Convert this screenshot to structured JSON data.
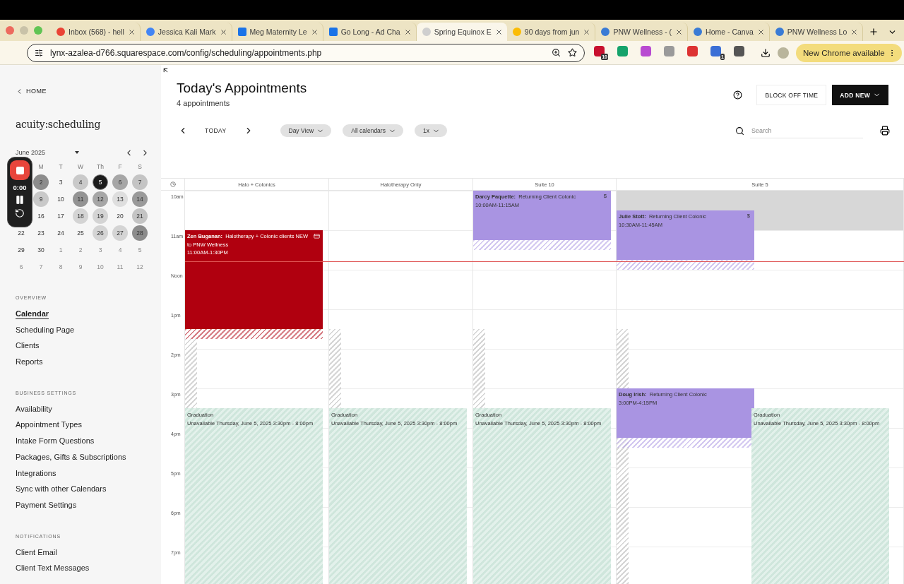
{
  "browser": {
    "tabs": [
      {
        "kind": "gmail",
        "title": "Inbox (568) - hell",
        "selected": false
      },
      {
        "kind": "calendar",
        "title": "Jessica Kali Mark",
        "selected": false
      },
      {
        "kind": "docs",
        "title": "Meg Maternity Le",
        "selected": false
      },
      {
        "kind": "docs",
        "title": "Go Long - Ad Cha",
        "selected": false
      },
      {
        "kind": "site",
        "title": "Spring Equinox E",
        "selected": true
      },
      {
        "kind": "google",
        "title": "90 days from jun",
        "selected": false
      },
      {
        "kind": "canva",
        "title": "PNW Wellness - (",
        "selected": false
      },
      {
        "kind": "canva",
        "title": "Home - Canva",
        "selected": false
      },
      {
        "kind": "canva",
        "title": "PNW Wellness Lo",
        "selected": false
      }
    ],
    "url": "lynx-azalea-d766.squarespace.com/config/scheduling/appointments.php",
    "extensions": [
      {
        "kind": "calendar",
        "badge": "10"
      },
      {
        "kind": "grammar"
      },
      {
        "kind": "orb"
      },
      {
        "kind": "camera"
      },
      {
        "kind": "chart"
      },
      {
        "kind": "tag",
        "badge": "1"
      },
      {
        "kind": "puzzle"
      }
    ],
    "update_button": "New Chrome available"
  },
  "sidebar": {
    "home": "HOME",
    "logo": "acuity:scheduling",
    "mini_calendar": {
      "month": "June 2025",
      "weekdays": [
        "M",
        "T",
        "W",
        "Th",
        "F",
        "S"
      ],
      "weeks": [
        [
          {
            "d": "2",
            "outside": false,
            "selected": false,
            "color": "#8c8c8c"
          },
          {
            "d": "3",
            "outside": false,
            "selected": false
          },
          {
            "d": "4",
            "outside": false,
            "selected": false,
            "color": "#c9c9c9"
          },
          {
            "d": "5",
            "outside": false,
            "selected": true
          },
          {
            "d": "6",
            "outside": false,
            "selected": false,
            "color": "#a6a6a6"
          },
          {
            "d": "7",
            "outside": false,
            "selected": false,
            "color": "#c4c4c4"
          }
        ],
        [
          {
            "d": "9",
            "outside": false,
            "selected": false,
            "color": "#c9c9c9"
          },
          {
            "d": "10",
            "outside": false,
            "selected": false
          },
          {
            "d": "11",
            "outside": false,
            "selected": false,
            "color": "#939393"
          },
          {
            "d": "12",
            "outside": false,
            "selected": false,
            "color": "#a6a6a6"
          },
          {
            "d": "13",
            "outside": false,
            "selected": false,
            "color": "#dedede"
          },
          {
            "d": "14",
            "outside": false,
            "selected": false,
            "color": "#9a9a9a"
          }
        ],
        [
          {
            "d": "16",
            "outside": false,
            "selected": false
          },
          {
            "d": "17",
            "outside": false,
            "selected": false
          },
          {
            "d": "18",
            "outside": false,
            "selected": false,
            "color": "#d4d4d4"
          },
          {
            "d": "19",
            "outside": false,
            "selected": false,
            "color": "#d4d4d4"
          },
          {
            "d": "20",
            "outside": false,
            "selected": false
          },
          {
            "d": "21",
            "outside": false,
            "selected": false,
            "color": "#c4c4c4"
          }
        ],
        [
          {
            "d": "22",
            "outside": false,
            "selected": false
          },
          {
            "d": "23",
            "outside": false,
            "selected": false
          },
          {
            "d": "24",
            "outside": false,
            "selected": false
          },
          {
            "d": "25",
            "outside": false,
            "selected": false
          },
          {
            "d": "26",
            "outside": false,
            "selected": false,
            "color": "#d4d4d4"
          },
          {
            "d": "27",
            "outside": false,
            "selected": false,
            "color": "#d4d4d4"
          },
          {
            "d": "28",
            "outside": false,
            "selected": false,
            "color": "#8c8c8c"
          }
        ],
        [
          {
            "d": "29",
            "outside": false,
            "selected": false
          },
          {
            "d": "30",
            "outside": false,
            "selected": false
          },
          {
            "d": "1",
            "outside": true,
            "selected": false
          },
          {
            "d": "2",
            "outside": true,
            "selected": false
          },
          {
            "d": "3",
            "outside": true,
            "selected": false
          },
          {
            "d": "4",
            "outside": true,
            "selected": false
          },
          {
            "d": "5",
            "outside": true,
            "selected": false
          }
        ],
        [
          {
            "d": "6",
            "outside": true,
            "selected": false
          },
          {
            "d": "7",
            "outside": true,
            "selected": false
          },
          {
            "d": "8",
            "outside": true,
            "selected": false
          },
          {
            "d": "9",
            "outside": true,
            "selected": false
          },
          {
            "d": "10",
            "outside": true,
            "selected": false
          },
          {
            "d": "11",
            "outside": true,
            "selected": false
          },
          {
            "d": "12",
            "outside": true,
            "selected": false
          }
        ]
      ]
    },
    "sections": [
      {
        "title": "OVERVIEW",
        "items": [
          {
            "label": "Calendar",
            "selected": true
          },
          {
            "label": "Scheduling Page",
            "selected": false
          },
          {
            "label": "Clients",
            "selected": false
          },
          {
            "label": "Reports",
            "selected": false
          }
        ]
      },
      {
        "title": "BUSINESS SETTINGS",
        "items": [
          {
            "label": "Availability",
            "selected": false
          },
          {
            "label": "Appointment Types",
            "selected": false
          },
          {
            "label": "Intake Form Questions",
            "selected": false
          },
          {
            "label": "Packages, Gifts & Subscriptions",
            "selected": false
          },
          {
            "label": "Integrations",
            "selected": false
          },
          {
            "label": "Sync with other Calendars",
            "selected": false
          },
          {
            "label": "Payment Settings",
            "selected": false
          }
        ]
      },
      {
        "title": "NOTIFICATIONS",
        "items": [
          {
            "label": "Client Email",
            "selected": false
          },
          {
            "label": "Client Text Messages",
            "selected": false
          }
        ]
      }
    ]
  },
  "recorder": {
    "time": "0:00"
  },
  "header": {
    "title": "Today's Appointments",
    "subtitle": "4 appointments",
    "block_button": "BLOCK OFF TIME",
    "add_button": "ADD NEW"
  },
  "toolbar": {
    "today": "TODAY",
    "filters": [
      "Day View",
      "All calendars",
      "1x"
    ],
    "search": {
      "placeholder": "Search"
    }
  },
  "calendar": {
    "hours": [
      "10am",
      "11am",
      "Noon",
      "1pm",
      "2pm",
      "3pm",
      "4pm",
      "5pm",
      "6pm",
      "7pm"
    ],
    "now_line": true,
    "columns": [
      {
        "name": "Halo + Colonics",
        "events": [
          {
            "kind": "appointment",
            "client": "Zen Buganan:",
            "type": "Halotherapy + Colonic clients NEW to PNW Wellness",
            "time": "11:00AM-1:30PM",
            "color": "#b0000f",
            "note": true
          },
          {
            "kind": "unavailable",
            "title": "Graduation",
            "detail": "Unavailable Thursday, June 5, 2025 3:30pm - 8:00pm"
          }
        ]
      },
      {
        "name": "Halotherapy Only",
        "events": [
          {
            "kind": "unavailable",
            "title": "Graduation",
            "detail": "Unavailable Thursday, June 5, 2025 3:30pm - 8:00pm"
          }
        ]
      },
      {
        "name": "Suite 10",
        "events": [
          {
            "kind": "appointment",
            "client": "Darcy Paquette:",
            "type": "Returning Client Colonic",
            "time": "10:00AM-11:15AM",
            "color": "#a994e2",
            "paid": "$"
          },
          {
            "kind": "unavailable",
            "title": "Graduation",
            "detail": "Unavailable Thursday, June 5, 2025 3:30pm - 8:00pm"
          }
        ]
      },
      {
        "name": "Suite 5",
        "events": [
          {
            "kind": "closed"
          },
          {
            "kind": "appointment",
            "client": "Julie Stott:",
            "type": "Returning Client Colonic",
            "time": "10:30AM-11:45AM",
            "color": "#a994e2",
            "paid": "$"
          },
          {
            "kind": "appointment",
            "client": "Doug Irish:",
            "type": "Returning Client Colonic",
            "time": "3:00PM-4:15PM",
            "color": "#a994e2"
          },
          {
            "kind": "unavailable",
            "title": "Graduation",
            "detail": "Unavailable Thursday, June 5, 2025 3:30pm - 8:00pm"
          }
        ]
      }
    ]
  }
}
